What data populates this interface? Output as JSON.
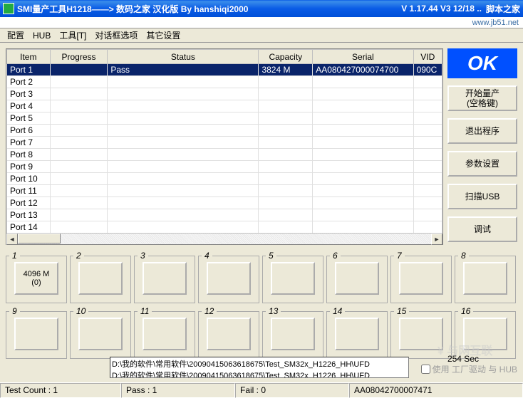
{
  "title_main": "SMI量产工具H1218——> 数码之家 汉化版 By hanshiqi2000",
  "title_ver": "V 1.17.44 V3 12/18 ..",
  "title_extra": "脚本之家",
  "subbar_url": "www.jb51.net",
  "menu": {
    "m0": "配置",
    "m1": "HUB",
    "m2": "工具[T]",
    "m3": "对话框选项",
    "m4": "其它设置"
  },
  "columns": {
    "c0": "Item",
    "c1": "Progress",
    "c2": "Status",
    "c3": "Capacity",
    "c4": "Serial",
    "c5": "VID"
  },
  "colw": {
    "c0": 60,
    "c1": 80,
    "c2": 210,
    "c3": 75,
    "c4": 140,
    "c5": 40
  },
  "rows": [
    {
      "item": "Port 1",
      "progress": "",
      "status": "Pass",
      "capacity": "3824 M",
      "serial": "AA080427000074700",
      "vid": "090C",
      "sel": true
    },
    {
      "item": "Port 2"
    },
    {
      "item": "Port 3"
    },
    {
      "item": "Port 4"
    },
    {
      "item": "Port 5"
    },
    {
      "item": "Port 6"
    },
    {
      "item": "Port 7"
    },
    {
      "item": "Port 8"
    },
    {
      "item": "Port 9"
    },
    {
      "item": "Port 10"
    },
    {
      "item": "Port 11"
    },
    {
      "item": "Port 12"
    },
    {
      "item": "Port 13"
    },
    {
      "item": "Port 14"
    }
  ],
  "ok_label": "OK",
  "buttons": {
    "start": "开始量产\n(空格键)",
    "exit": "退出程序",
    "param": "参数设置",
    "scan": "扫描USB",
    "debug": "调试"
  },
  "slots": [
    {
      "n": "1",
      "v1": "4096 M",
      "v2": "(0)"
    },
    {
      "n": "2"
    },
    {
      "n": "3"
    },
    {
      "n": "4"
    },
    {
      "n": "5"
    },
    {
      "n": "6"
    },
    {
      "n": "7"
    },
    {
      "n": "8"
    },
    {
      "n": "9"
    },
    {
      "n": "10"
    },
    {
      "n": "11"
    },
    {
      "n": "12"
    },
    {
      "n": "13"
    },
    {
      "n": "14"
    },
    {
      "n": "15"
    },
    {
      "n": "16"
    }
  ],
  "log": "D:\\我的软件\\常用软件\\20090415063618675\\Test_SM32x_H1226_HH\\UFD\nD:\\我的软件\\常用软件\\20090415063618675\\Test_SM32x_H1226_HH\\UFD",
  "sec_label": "254 Sec",
  "hub_chk": "使用 工厂驱动 与 HUB",
  "status": {
    "s0": "Test Count :  1",
    "s1": "Pass :  1",
    "s2": "Fail :  0",
    "s3": "AA08042700007471"
  }
}
